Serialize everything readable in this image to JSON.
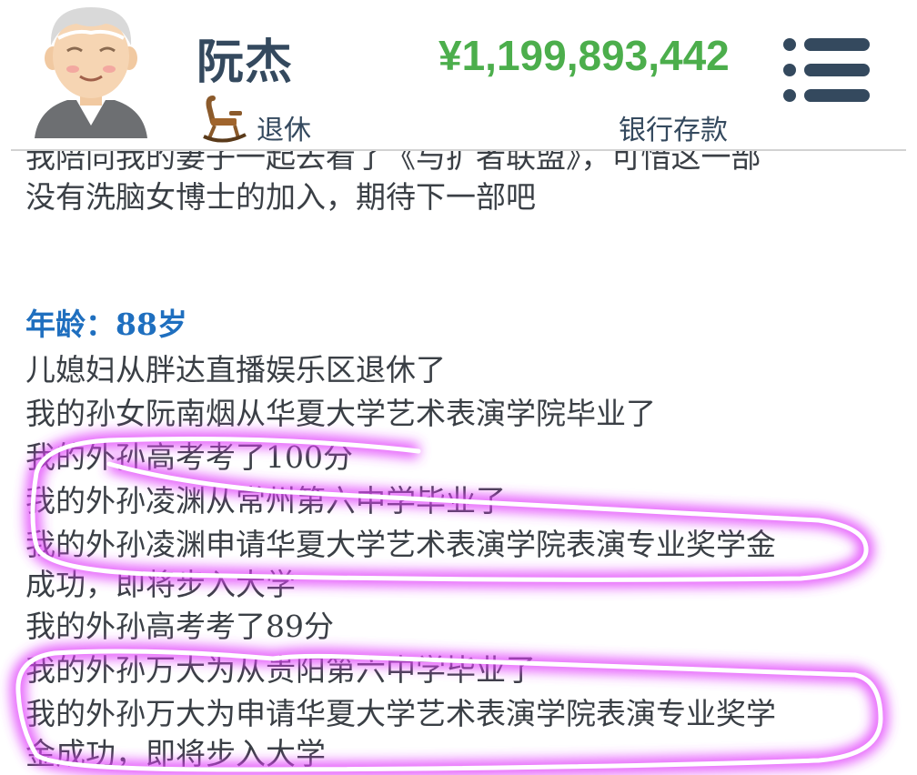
{
  "header": {
    "name": "阮杰",
    "status": "退休",
    "balance": "¥1,199,893,442",
    "balance_label": "银行存款",
    "avatar_icon": "old-man-avatar-icon",
    "status_icon": "rocking-chair-icon",
    "menu_icon": "menu-icon"
  },
  "log": {
    "partial_line": "我陪同我的妻子一起去看了《与扩者联盟》，可惜这一部",
    "prev_line": "没有洗脑女博士的加入，期待下一部吧",
    "age_heading": "年龄：88岁",
    "entries": [
      "儿媳妇从胖达直播娱乐区退休了",
      "我的孙女阮南烟从华夏大学艺术表演学院毕业了",
      "我的外孙高考考了100分",
      "我的外孙凌渊从常州第六中学毕业了",
      "我的外孙凌渊申请华夏大学艺术表演学院表演专业奖学金",
      "成功，即将步入大学",
      "我的外孙高考考了89分",
      "我的外孙万大为从贵阳第六中学毕业了",
      "我的外孙万大为申请华夏大学艺术表演学院表演专业奖学",
      "金成功，即将步入大学"
    ]
  },
  "colors": {
    "accent": "#34495e",
    "money": "#4cae4c",
    "age": "#1f6fbf",
    "highlight": "#e040fb"
  }
}
